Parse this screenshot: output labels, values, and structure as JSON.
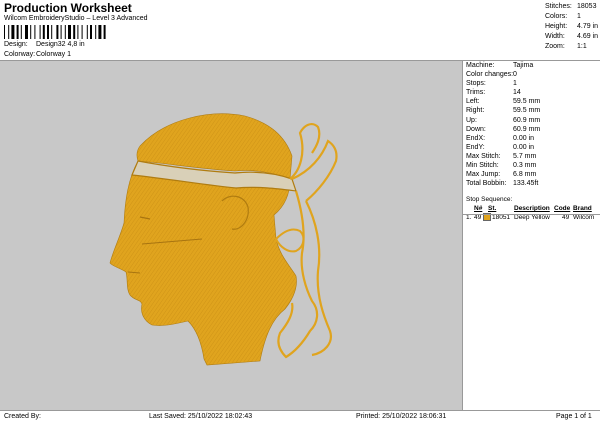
{
  "header": {
    "title": "Production Worksheet",
    "subtitle": "Wilcom EmbroideryStudio – Level 3 Advanced",
    "design_label": "Design:",
    "design_value": "Design32 4,8 in",
    "colorway_label": "Colorway:",
    "colorway_value": "Colorway 1"
  },
  "summary": [
    {
      "label": "Stitches:",
      "value": "18053"
    },
    {
      "label": "Colors:",
      "value": "1"
    },
    {
      "label": "Height:",
      "value": "4.79 in"
    },
    {
      "label": "Width:",
      "value": "4.69 in"
    },
    {
      "label": "Zoom:",
      "value": "1:1"
    }
  ],
  "specs": [
    {
      "label": "Machine:",
      "value": "Tajima"
    },
    {
      "label": "Color changes:",
      "value": "0"
    },
    {
      "label": "Stops:",
      "value": "1"
    },
    {
      "label": "Trims:",
      "value": "14"
    },
    {
      "label": "Left:",
      "value": "59.5 mm"
    },
    {
      "label": "Right:",
      "value": "59.5 mm"
    },
    {
      "label": "Up:",
      "value": "60.9 mm"
    },
    {
      "label": "Down:",
      "value": "60.9 mm"
    },
    {
      "label": "EndX:",
      "value": "0.00 in"
    },
    {
      "label": "EndY:",
      "value": "0.00 in"
    },
    {
      "label": "Max Stitch:",
      "value": "5.7 mm"
    },
    {
      "label": "Min Stitch:",
      "value": "0.3 mm"
    },
    {
      "label": "Max Jump:",
      "value": "6.8 mm"
    },
    {
      "label": "Total Bobbin:",
      "value": "133.45ft"
    }
  ],
  "stop_sequence": {
    "title": "Stop Sequence:",
    "columns": [
      "N#",
      "St.",
      "Description",
      "Code",
      "Brand"
    ],
    "rows": [
      {
        "index": "1.",
        "n": "49",
        "st": "18051",
        "description": "Deep Yellow",
        "code": "49",
        "brand": "Wilcom",
        "color": "#e0a41e"
      }
    ]
  },
  "footer": {
    "created_by": "Created By:",
    "last_saved": "Last Saved: 25/10/2022 18:02:43",
    "printed": "Printed: 25/10/2022 18:06:31",
    "page": "Page 1 of 1"
  },
  "colors": {
    "thread": "#e0a41e",
    "canvas": "#c8c8c8"
  }
}
